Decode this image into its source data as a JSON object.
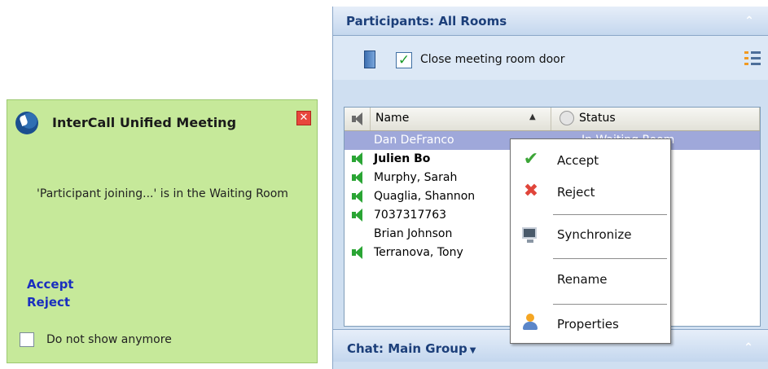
{
  "toast": {
    "title": "InterCall Unified Meeting",
    "close_glyph": "✕",
    "message": "'Participant joining...' is in the Waiting Room",
    "accept_label": "Accept",
    "reject_label": "Reject",
    "do_not_show_label": "Do not show anymore",
    "do_not_show_checked": false
  },
  "participants_panel": {
    "title": "Participants: All Rooms",
    "collapse_glyph": "⌃",
    "close_door_label": "Close meeting room door",
    "close_door_checked": true,
    "check_glyph": "✓",
    "columns": {
      "name": "Name",
      "status": "Status"
    },
    "sort_glyph": "▲",
    "rows": [
      {
        "name": "Dan DeFranco",
        "status": "In Waiting Room",
        "speaker": "none",
        "selected": true,
        "bold": false
      },
      {
        "name": "Julien Bo",
        "status": "",
        "speaker": "green",
        "selected": false,
        "bold": true
      },
      {
        "name": "Murphy, Sarah",
        "status": "",
        "speaker": "green",
        "selected": false,
        "bold": false
      },
      {
        "name": "Quaglia, Shannon",
        "status": "",
        "speaker": "green",
        "selected": false,
        "bold": false
      },
      {
        "name": "7037317763",
        "status": "",
        "speaker": "green",
        "selected": false,
        "bold": false
      },
      {
        "name": "Brian Johnson",
        "status": "",
        "speaker": "none",
        "selected": false,
        "bold": false
      },
      {
        "name": "Terranova, Tony",
        "status": "",
        "speaker": "green",
        "selected": false,
        "bold": false
      }
    ]
  },
  "context_menu": {
    "accept": "Accept",
    "accept_glyph": "✔",
    "reject": "Reject",
    "reject_glyph": "✖",
    "synchronize": "Synchronize",
    "rename": "Rename",
    "properties": "Properties"
  },
  "chat": {
    "title": "Chat: Main Group",
    "caret": "▼",
    "collapse_glyph": "⌃"
  },
  "colors": {
    "toast_bg": "#c6e99a",
    "panel_header": "#c4d7ee",
    "selected_row": "#9fa8da",
    "speaker_green": "#2aa534",
    "link_blue": "#1a2fbf"
  }
}
